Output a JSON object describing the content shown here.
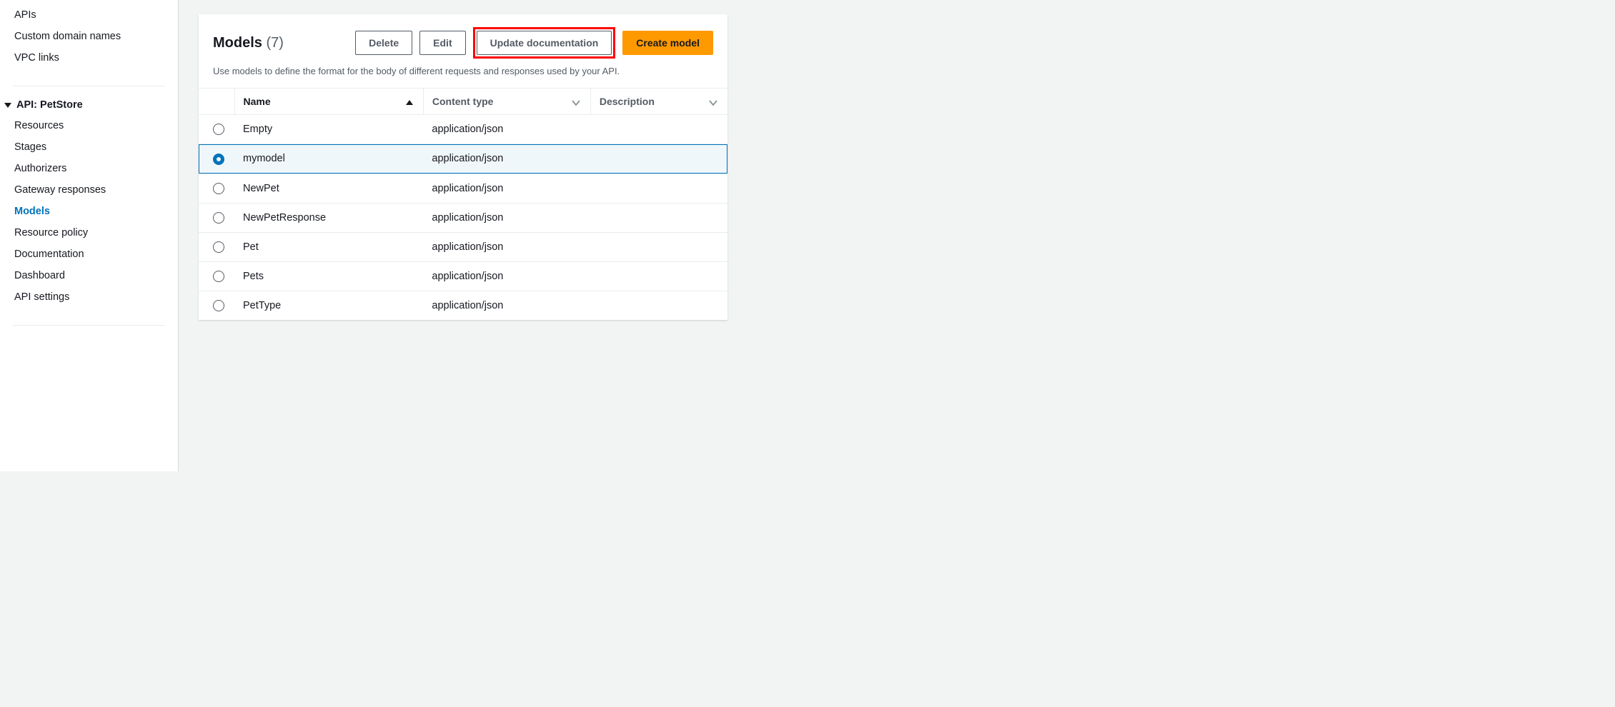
{
  "sidebar": {
    "top_items": [
      {
        "label": "APIs"
      },
      {
        "label": "Custom domain names"
      },
      {
        "label": "VPC links"
      }
    ],
    "group_label": "API: PetStore",
    "group_items": [
      {
        "label": "Resources",
        "active": false
      },
      {
        "label": "Stages",
        "active": false
      },
      {
        "label": "Authorizers",
        "active": false
      },
      {
        "label": "Gateway responses",
        "active": false
      },
      {
        "label": "Models",
        "active": true
      },
      {
        "label": "Resource policy",
        "active": false
      },
      {
        "label": "Documentation",
        "active": false
      },
      {
        "label": "Dashboard",
        "active": false
      },
      {
        "label": "API settings",
        "active": false
      }
    ]
  },
  "panel": {
    "title": "Models",
    "count": "(7)",
    "description": "Use models to define the format for the body of different requests and responses used by your API.",
    "actions": {
      "delete": "Delete",
      "edit": "Edit",
      "update_doc": "Update documentation",
      "create": "Create model"
    }
  },
  "table": {
    "headers": {
      "name": "Name",
      "content_type": "Content type",
      "description": "Description"
    },
    "rows": [
      {
        "name": "Empty",
        "content_type": "application/json",
        "description": "",
        "selected": false
      },
      {
        "name": "mymodel",
        "content_type": "application/json",
        "description": "",
        "selected": true
      },
      {
        "name": "NewPet",
        "content_type": "application/json",
        "description": "",
        "selected": false
      },
      {
        "name": "NewPetResponse",
        "content_type": "application/json",
        "description": "",
        "selected": false
      },
      {
        "name": "Pet",
        "content_type": "application/json",
        "description": "",
        "selected": false
      },
      {
        "name": "Pets",
        "content_type": "application/json",
        "description": "",
        "selected": false
      },
      {
        "name": "PetType",
        "content_type": "application/json",
        "description": "",
        "selected": false
      }
    ]
  }
}
